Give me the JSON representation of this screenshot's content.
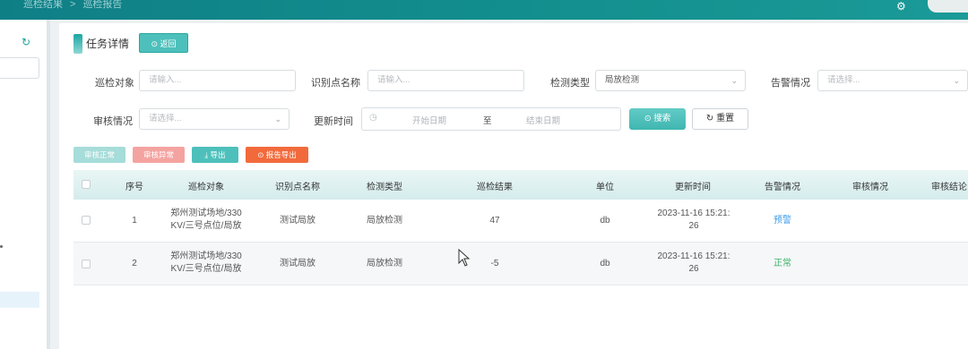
{
  "breadcrumb": {
    "parent": "巡检结果",
    "sep": ">",
    "current": "巡检报告"
  },
  "page": {
    "title": "任务详情",
    "back_label": "返回"
  },
  "filters": {
    "target_label": "巡检对象",
    "target_placeholder": "请输入...",
    "point_label": "识别点名称",
    "point_placeholder": "请输入...",
    "type_label": "检测类型",
    "type_value": "局放检测",
    "alarm_label": "告警情况",
    "alarm_placeholder": "请选择...",
    "review_label": "审核情况",
    "review_placeholder": "请选择...",
    "time_label": "更新时间",
    "start_placeholder": "开始日期",
    "to_label": "至",
    "end_placeholder": "结束日期",
    "search_label": "搜索",
    "reset_label": "重置"
  },
  "actions": {
    "approve": "审核正常",
    "reject": "审核异常",
    "export": "导出",
    "report": "报告导出"
  },
  "colors": {
    "accent": "#1aa3a0",
    "warn": "#3d9be9",
    "normal": "#3db36a",
    "reject": "#f4a3a0",
    "report": "#f26a3c"
  },
  "table": {
    "headers": [
      "序号",
      "巡检对象",
      "识别点名称",
      "检测类型",
      "巡检结果",
      "单位",
      "更新时间",
      "告警情况",
      "审核情况",
      "审核结论"
    ],
    "rows": [
      {
        "index": "1",
        "target_l1": "郑州测试场地/330",
        "target_l2": "KV/三号点位/局放",
        "point": "测试局放",
        "type": "局放检测",
        "result": "47",
        "unit": "db",
        "time_l1": "2023-11-16 15:21:",
        "time_l2": "26",
        "alarm": "预警",
        "review": "",
        "conclusion": ""
      },
      {
        "index": "2",
        "target_l1": "郑州测试场地/330",
        "target_l2": "KV/三号点位/局放",
        "point": "测试局放",
        "type": "局放检测",
        "result": "-5",
        "unit": "db",
        "time_l1": "2023-11-16 15:21:",
        "time_l2": "26",
        "alarm": "正常",
        "review": "",
        "conclusion": ""
      }
    ]
  }
}
